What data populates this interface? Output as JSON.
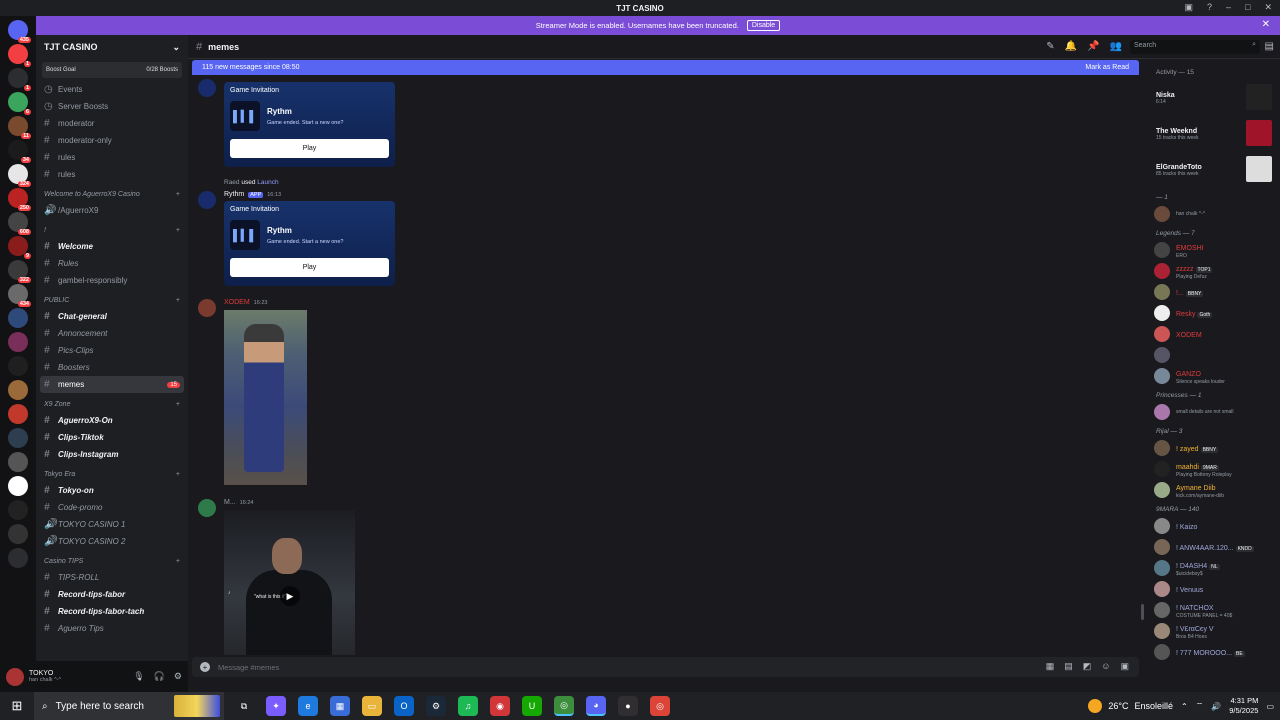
{
  "window": {
    "title": "TJT CASINO"
  },
  "streamer": {
    "text": "Streamer Mode is enabled. Usernames have been truncated.",
    "button": "Disable"
  },
  "server": {
    "name": "TJT CASINO",
    "boost_label": "Boost Goal",
    "boost_count": "0/28 Boosts"
  },
  "server_badges": [
    "435",
    "1",
    "1",
    "6",
    "11",
    "34",
    "324",
    "250",
    "608",
    "9",
    "322",
    "434"
  ],
  "channels": {
    "top": [
      {
        "label": "Events",
        "icon": "calendar-icon"
      },
      {
        "label": "Server Boosts",
        "icon": "boost-icon"
      }
    ],
    "list1": [
      {
        "label": "moderator"
      },
      {
        "label": "moderator-only"
      },
      {
        "label": "rules"
      },
      {
        "label": "rules"
      }
    ],
    "cat_welcome": "Welcome to AguerroX9 Casino",
    "voice1": "/AguerroX9",
    "cat_bang": "!",
    "list2": [
      {
        "label": "Welcome",
        "style": "b"
      },
      {
        "label": "Rules",
        "style": "i"
      },
      {
        "label": "gambel-responsibly",
        "style": ""
      }
    ],
    "cat_public": "PUBLIC",
    "list3": [
      {
        "label": "Chat-general",
        "style": "b"
      },
      {
        "label": "Annoncement",
        "style": "i"
      },
      {
        "label": "Pics-Clips",
        "style": "i"
      },
      {
        "label": "Boosters",
        "style": "i"
      }
    ],
    "selected": {
      "label": "memes",
      "badge": "15"
    },
    "cat_x9": "X9 Zone",
    "list4": [
      {
        "label": "AguerroX9-On",
        "style": "b"
      },
      {
        "label": "Clips-Tiktok",
        "style": "b"
      },
      {
        "label": "Clips-Instagram",
        "style": "b"
      }
    ],
    "cat_tokyo": "Tokyo Era",
    "list5": [
      {
        "label": "Tokyo-on",
        "style": "b"
      },
      {
        "label": "Code-promo",
        "style": "i"
      },
      {
        "label": "TOKYO CASINO 1",
        "style": "i"
      },
      {
        "label": "TOKYO CASINO 2",
        "style": "i"
      }
    ],
    "cat_tips": "Casino TIPS",
    "list6": [
      {
        "label": "TIPS-ROLL",
        "style": "i"
      },
      {
        "label": "Record-tips-fabor",
        "style": "b"
      },
      {
        "label": "Record-tips-fabor-tach",
        "style": "b"
      },
      {
        "label": "Aguerro Tips",
        "style": "i"
      }
    ]
  },
  "user": {
    "name": "TOKYO",
    "status": "han chalk ^-^"
  },
  "header": {
    "channel": "memes",
    "search_placeholder": "Search"
  },
  "newbar": {
    "text": "115 new messages since 08:50",
    "action": "Mark as Read"
  },
  "messages": {
    "card_label": "Game Invitation",
    "card_bot": "Rythm",
    "card_status": "Game ended. Start a new one?",
    "card_button": "Play",
    "sys_user": "Raed",
    "sys_used": "used",
    "sys_launch": "Launch",
    "bot_name": "Rythm",
    "bot_tag": "APP",
    "bot_time": "16:13",
    "msg3_user": "XODEM",
    "msg3_time": "16:23",
    "msg4_user": "M...",
    "msg4_time": "16:24",
    "video_caption": "\"what is this it\""
  },
  "composer": {
    "placeholder": "Message #memes"
  },
  "activity": {
    "title": "Activity — 15",
    "items": [
      {
        "name": "Niska",
        "sub": "6:14"
      },
      {
        "name": "The Weeknd",
        "sub": "15 tracks this week"
      },
      {
        "name": "ElGrandeToto",
        "sub": "85 tracks this week"
      }
    ]
  },
  "member_groups": [
    {
      "title": "— 1",
      "members": [
        {
          "name": "",
          "sub": "han chalk ^-^",
          "color": "#f2f3f5"
        }
      ]
    },
    {
      "title": "Legends — 7",
      "members": [
        {
          "name": "EMOSHI",
          "sub": "ERO",
          "color": "#e03b3b"
        },
        {
          "name": "zzzzz",
          "tag": "TOP1",
          "sub": "Playing Defuz",
          "color": "#e03b3b"
        },
        {
          "name": "!...",
          "tag": "BBNY",
          "sub": "",
          "color": "#e03b3b"
        },
        {
          "name": "Resky",
          "tag": "Goth",
          "sub": "",
          "color": "#e03b3b"
        },
        {
          "name": "XODEM",
          "sub": "",
          "color": "#e03b3b"
        },
        {
          "name": "",
          "sub": "",
          "color": "#f2f3f5"
        },
        {
          "name": "GANZO",
          "sub": "Silence speaks louder",
          "color": "#e03b3b"
        }
      ]
    },
    {
      "title": "Princesses — 1",
      "members": [
        {
          "name": "",
          "sub": "small details are not small",
          "color": "#f2f3f5"
        }
      ]
    },
    {
      "title": "Rijal — 3",
      "members": [
        {
          "name": "! zayed",
          "tag": "BBNY",
          "sub": "",
          "color": "#f0b232"
        },
        {
          "name": "maahdi",
          "tag": "9MAR",
          "sub": "Playing Bottony Roleplay",
          "color": "#f0b232"
        },
        {
          "name": "Aymane Diib",
          "sub": "kick.com/aymane-diib",
          "color": "#f0b232"
        }
      ]
    },
    {
      "title": "9MARA — 140",
      "members": [
        {
          "name": "! Kaizo",
          "sub": "",
          "color": "#9fa8da"
        },
        {
          "name": "! ANW4AAR.120...",
          "tag": "KNDD",
          "sub": "",
          "color": "#9fa8da"
        },
        {
          "name": "! D4ASH4",
          "tag": "NL",
          "sub": "$uicideboy$",
          "color": "#9fa8da"
        },
        {
          "name": "! Venuus",
          "sub": "",
          "color": "#9fa8da"
        },
        {
          "name": "! NATCHOX",
          "sub": "COSTUME PANEL = 40$",
          "color": "#9fa8da"
        },
        {
          "name": "! V£rαCєy V",
          "sub": "Bros B4 Hoes",
          "color": "#9fa8da"
        },
        {
          "name": "! 777 MOROOO...",
          "tag": "BE",
          "sub": "",
          "color": "#9fa8da"
        }
      ]
    }
  ],
  "taskbar": {
    "search": "Type here to search",
    "temp": "26°C",
    "weather": "Ensoleillé",
    "time": "4:31 PM",
    "date": "9/5/2025"
  },
  "colors": {
    "accent": "#5865f2",
    "banner": "#7b4dd6",
    "danger": "#f23f42"
  }
}
